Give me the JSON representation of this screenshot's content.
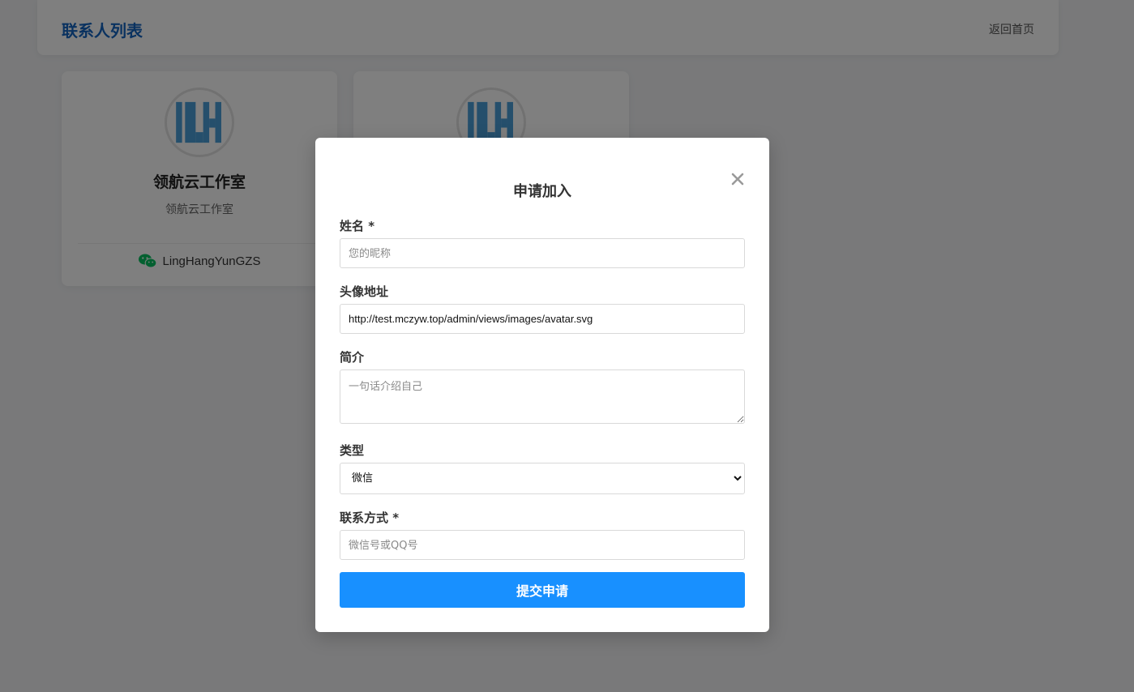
{
  "header": {
    "title": "联系人列表",
    "home_link": "返回首页"
  },
  "cards": [
    {
      "name": "领航云工作室",
      "desc": "领航云工作室",
      "contact_type_icon": "wechat-icon",
      "contact": "LingHangYunGZS"
    },
    {
      "avatar_icon": "lh-logo"
    }
  ],
  "modal": {
    "title": "申请加入",
    "close_icon": "close-icon",
    "fields": {
      "name": {
        "label": "姓名 *",
        "placeholder": "您的昵称",
        "value": ""
      },
      "avatar": {
        "label": "头像地址",
        "value": "http://test.mczyw.top/admin/views/images/avatar.svg"
      },
      "intro": {
        "label": "简介",
        "placeholder": "一句话介绍自己"
      },
      "type": {
        "label": "类型",
        "selected": "微信"
      },
      "contact": {
        "label": "联系方式 *",
        "placeholder": "微信号或QQ号"
      }
    },
    "submit_label": "提交申请"
  },
  "colors": {
    "brand_blue": "#1565c0",
    "button_blue": "#1890ff",
    "wechat_green": "#07c160",
    "logo_blue": "#4a9fd8"
  }
}
